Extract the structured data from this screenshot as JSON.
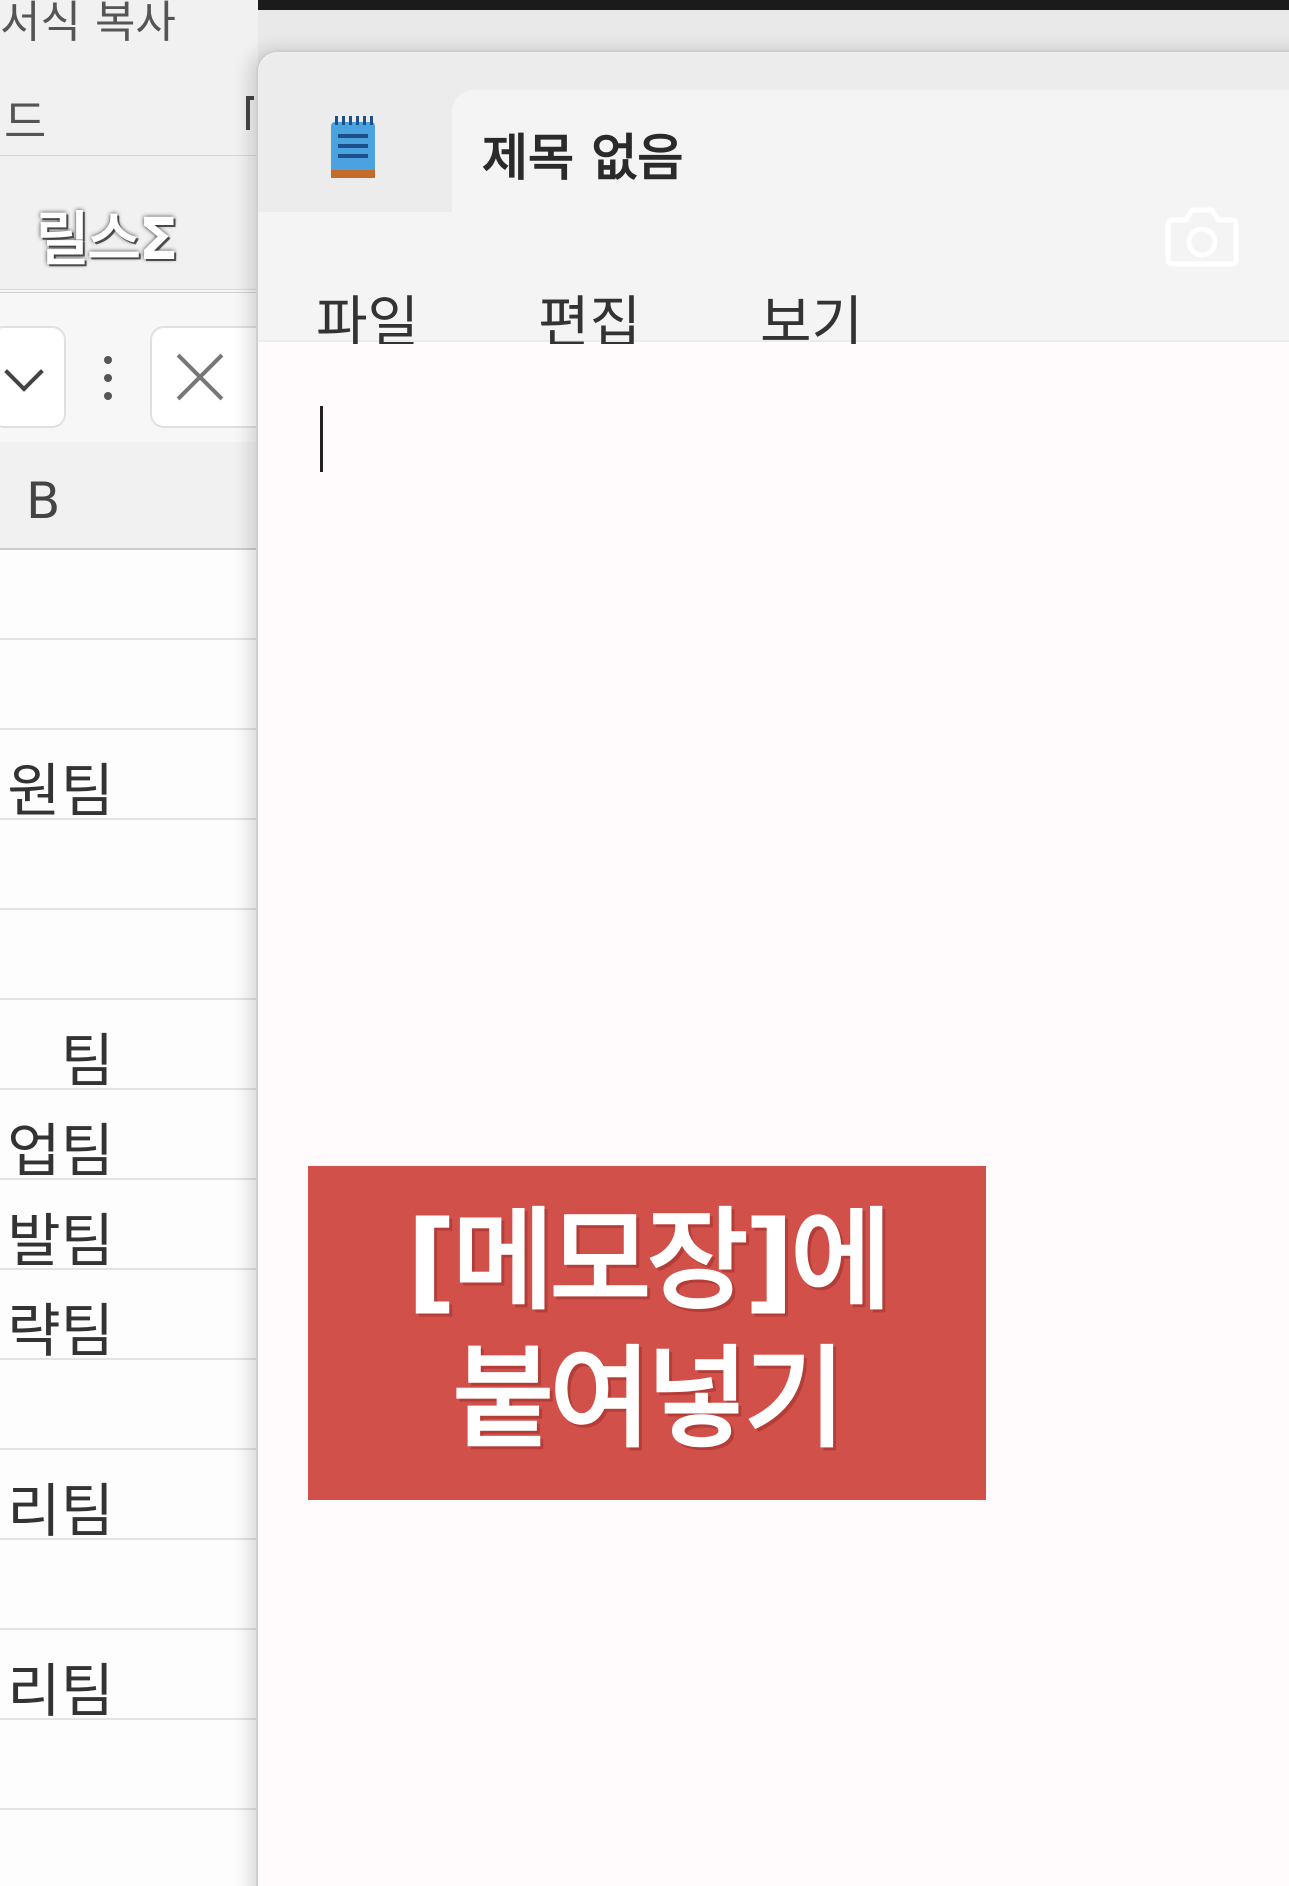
{
  "spreadsheet": {
    "ribbon_text_1": "서식 복사",
    "ribbon_text_2": "드",
    "ribbon_function": "릴스Σ",
    "column_header": "B",
    "rows": [
      "",
      "",
      "원팀",
      "",
      "",
      "팀",
      "업팀",
      "발팀",
      "략팀",
      "",
      "리팀",
      "",
      "리팀",
      "",
      ""
    ]
  },
  "notepad": {
    "app_icon": "notepad-icon",
    "title": "제목 없음",
    "menu": {
      "file": "파일",
      "edit": "편집",
      "view": "보기"
    },
    "camera_icon": "camera-icon",
    "content": ""
  },
  "overlay": {
    "line1": "[메모장]에",
    "line2": "붙여넣기",
    "color": "#d2504a"
  }
}
